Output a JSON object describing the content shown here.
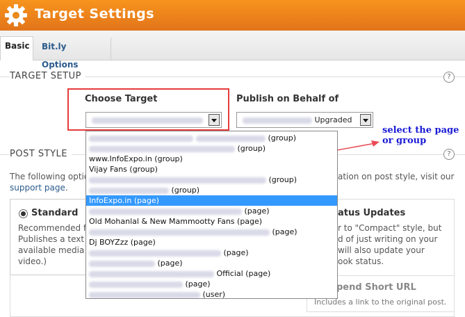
{
  "header": {
    "title": "Target Settings"
  },
  "tabs": [
    {
      "label": "Basic"
    },
    {
      "label": "Bit.ly Options"
    }
  ],
  "target_setup": {
    "title": "TARGET SETUP",
    "choose_label": "Choose Target",
    "publish_label": "Publish on Behalf of",
    "publish_value_suffix": "Upgraded",
    "help": "?"
  },
  "dropdown": {
    "items": [
      {
        "text": "(group)"
      },
      {
        "text": "(group)"
      },
      {
        "text": "www.InfoExpo.in (group)"
      },
      {
        "text": "Vijay Fans (group)"
      },
      {
        "text": "(group)"
      },
      {
        "text": "(group)"
      },
      {
        "text": "InfoExpo.in (page)"
      },
      {
        "text": "(page)"
      },
      {
        "text": "Old Mohanlal & New Mammootty Fans (page)"
      },
      {
        "text": "(page)"
      },
      {
        "text": "Dj BOYZzz (page)"
      },
      {
        "text": "(page)"
      },
      {
        "text": "(page)"
      },
      {
        "text": "Official (page)"
      },
      {
        "text": "(page)"
      },
      {
        "text": "(user)"
      }
    ]
  },
  "annotation": {
    "line1": "select the page",
    "line2": "or group"
  },
  "post_style": {
    "title": "POST STYLE",
    "help": "?",
    "intro_left": "The following optio",
    "intro_right": "ation on post style, visit our",
    "support_link": "support page",
    "intro_end": ".",
    "standard": {
      "title": "Standard",
      "lines": [
        "Recommended fo",
        "Publishes a text (",
        "available media (",
        "video.)"
      ]
    },
    "status": {
      "title": "atus Updates",
      "lines": [
        "r to \"Compact\" style, but",
        "d of just writing on your",
        "will also update your",
        "ook status."
      ]
    },
    "short_url": {
      "title": "pend Short URL",
      "desc": "Includes a link to the original post."
    }
  },
  "colors": {
    "header": "#e98b1c",
    "selected": "#3399ff",
    "annotation": "#1a1ad6",
    "highlight": "#e53b3b"
  }
}
